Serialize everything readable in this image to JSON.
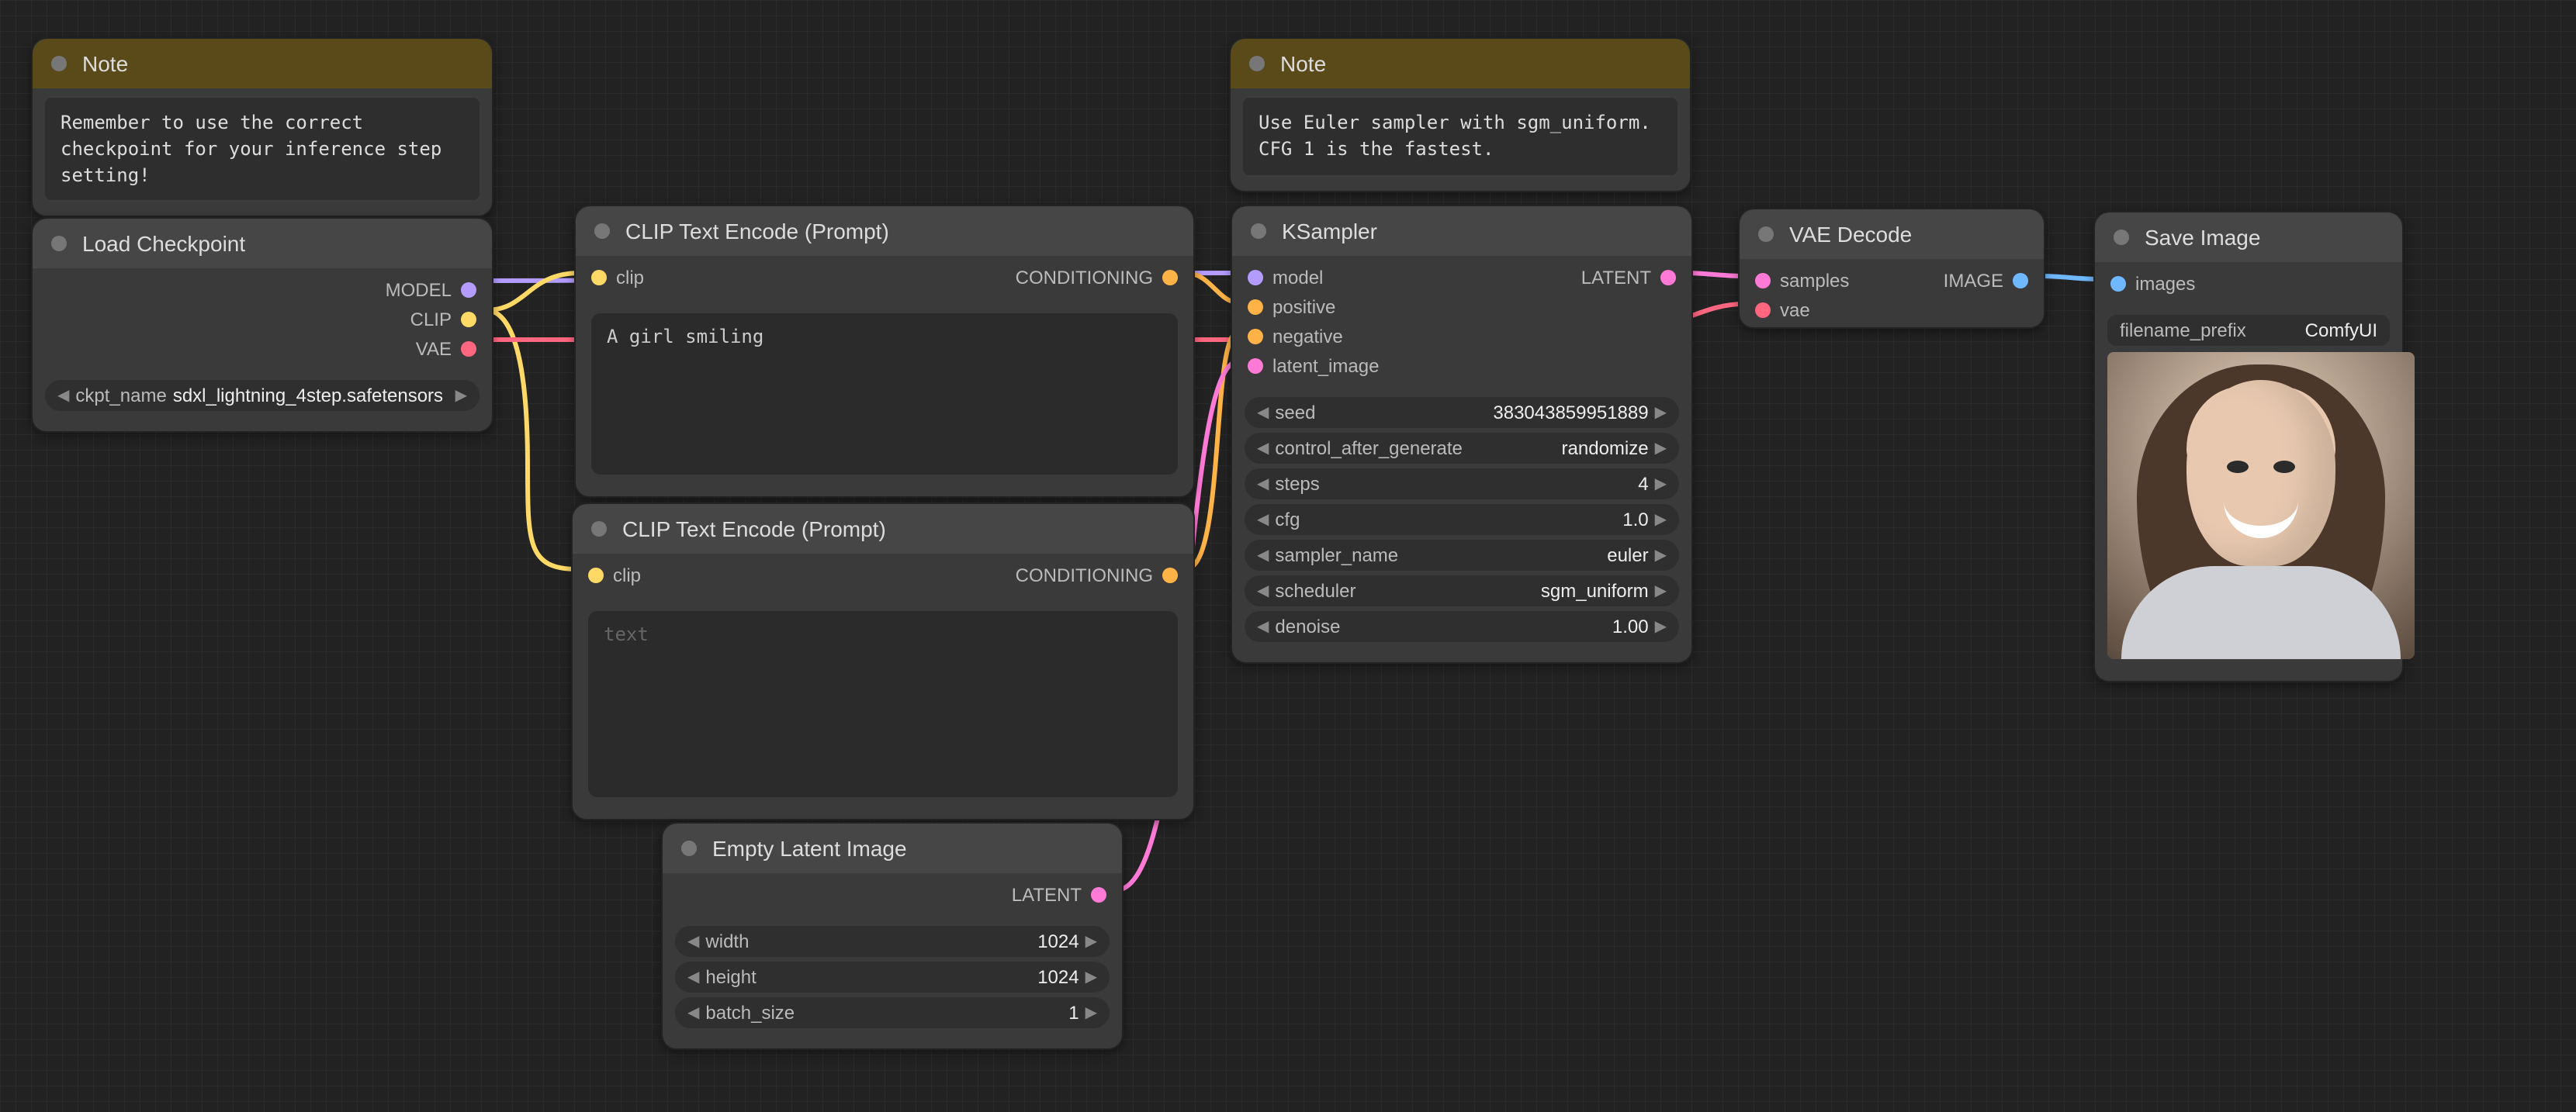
{
  "notes": {
    "note1": {
      "title": "Note",
      "text": "Remember to use the correct checkpoint for your inference step setting!"
    },
    "note2": {
      "title": "Note",
      "text": "Use Euler sampler with sgm_uniform.\nCFG 1 is the fastest."
    }
  },
  "load_checkpoint": {
    "title": "Load Checkpoint",
    "outputs": {
      "model": "MODEL",
      "clip": "CLIP",
      "vae": "VAE"
    },
    "widget": {
      "name": "ckpt_name",
      "value": "sdxl_lightning_4step.safetensors"
    }
  },
  "clip_pos": {
    "title": "CLIP Text Encode (Prompt)",
    "input": "clip",
    "output": "CONDITIONING",
    "text": "A girl smiling"
  },
  "clip_neg": {
    "title": "CLIP Text Encode (Prompt)",
    "input": "clip",
    "output": "CONDITIONING",
    "placeholder": "text"
  },
  "empty_latent": {
    "title": "Empty Latent Image",
    "output": "LATENT",
    "widgets": {
      "width": {
        "name": "width",
        "value": "1024"
      },
      "height": {
        "name": "height",
        "value": "1024"
      },
      "batch": {
        "name": "batch_size",
        "value": "1"
      }
    }
  },
  "ksampler": {
    "title": "KSampler",
    "inputs": {
      "model": "model",
      "positive": "positive",
      "negative": "negative",
      "latent_image": "latent_image"
    },
    "output": "LATENT",
    "widgets": {
      "seed": {
        "name": "seed",
        "value": "383043859951889"
      },
      "control": {
        "name": "control_after_generate",
        "value": "randomize"
      },
      "steps": {
        "name": "steps",
        "value": "4"
      },
      "cfg": {
        "name": "cfg",
        "value": "1.0"
      },
      "sampler": {
        "name": "sampler_name",
        "value": "euler"
      },
      "scheduler": {
        "name": "scheduler",
        "value": "sgm_uniform"
      },
      "denoise": {
        "name": "denoise",
        "value": "1.00"
      }
    }
  },
  "vae_decode": {
    "title": "VAE Decode",
    "inputs": {
      "samples": "samples",
      "vae": "vae"
    },
    "output": "IMAGE"
  },
  "save_image": {
    "title": "Save Image",
    "input": "images",
    "widget": {
      "name": "filename_prefix",
      "value": "ComfyUI"
    }
  }
}
